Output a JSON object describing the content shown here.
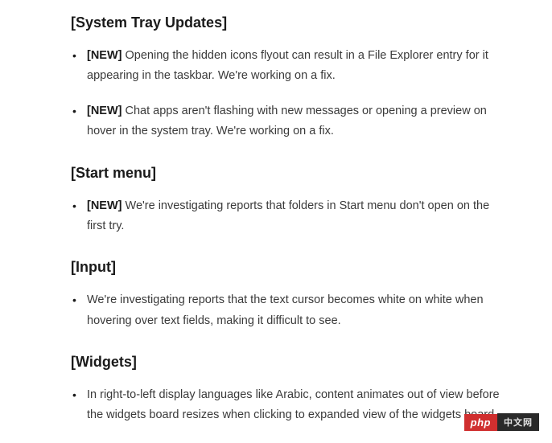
{
  "sections": [
    {
      "heading": "[System Tray Updates]",
      "items": [
        {
          "tag": "[NEW]",
          "text": "Opening the hidden icons flyout can result in a File Explorer entry for it appearing in the taskbar. We're working on a fix."
        },
        {
          "tag": "[NEW]",
          "text": "Chat apps aren't flashing with new messages or opening a preview on hover in the system tray. We're working on a fix."
        }
      ]
    },
    {
      "heading": "[Start menu]",
      "items": [
        {
          "tag": "[NEW]",
          "text": "We're investigating reports that folders in Start menu don't open on the first try."
        }
      ]
    },
    {
      "heading": "[Input]",
      "items": [
        {
          "tag": "",
          "text": "We're investigating reports that the text cursor becomes white on white when hovering over text fields, making it difficult to see."
        }
      ]
    },
    {
      "heading": "[Widgets]",
      "items": [
        {
          "tag": "",
          "text": "In right-to-left display languages like Arabic, content animates out of view before the widgets board resizes when clicking to expanded view of the widgets board."
        }
      ]
    }
  ],
  "watermark": {
    "left": "php",
    "right": "中文网"
  }
}
